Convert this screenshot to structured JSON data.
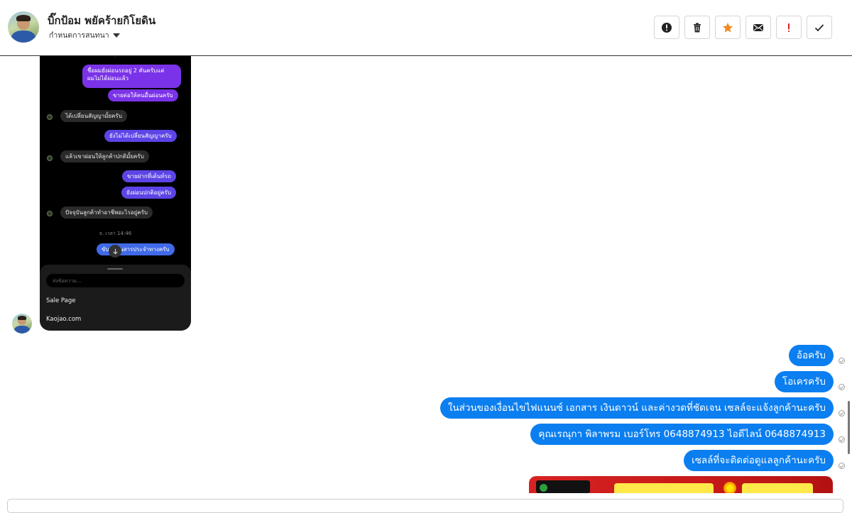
{
  "header": {
    "name": "บิ๊กป้อม พยัคร้ายกิโยดิน",
    "subtitle": "กำหนดการสนทนา"
  },
  "toolbar": {
    "buttons": [
      "alert-circle-icon",
      "trash-icon",
      "star-icon",
      "envelope-icon",
      "exclamation-icon",
      "check-icon"
    ],
    "star_color": "#f08a24",
    "alert_color": "#e02020"
  },
  "screenshot": {
    "messages": [
      "ชื่อผมยังผ่อนรถอยู่ 2 คันครับแต่",
      "ผมไม่ได้ผ่อนแล้ว",
      "ขายต่อให้คนอื่นผ่อนครับ",
      "ได้เปลี่ยนสัญญามั้ยครับ",
      "ยังไม่ได้เปลี่ยนสัญญาครับ",
      "แล้วเขาผ่อนให้ลูกค้าปกติมั้ยครับ",
      "ขายฝากที่เต้นท์รถ",
      "ยังผ่อนปกติอยู่ครับ",
      "ปัจจุบันลูกค้าทำอาชีพอะไรอยู่ครับ",
      "ขับรถขนสารประจำทางครับ"
    ],
    "timestamp": "จ. เวลา 14:46",
    "input_placeholder": "ส่งข้อความ...",
    "link1": "Sale Page",
    "link2": "Kaojao.com"
  },
  "replies": [
    "อ้อครับ",
    "โอเครครับ",
    "ในส่วนของเงื่อนไขไฟแนนซ์ เอกสาร เงินดาวน์ และค่างวดที่ชัดเจน เซลล์จะแจ้งลูกค้านะครับ",
    "คุณเรณุกา พิลาพรม    เบอร์โทร 0648874913       ไอดีไลน์ 0648874913",
    "เซลล์ที่จะติดต่อดูแลลูกค้านะครับ"
  ],
  "bubble_color": "#0b7ef0"
}
